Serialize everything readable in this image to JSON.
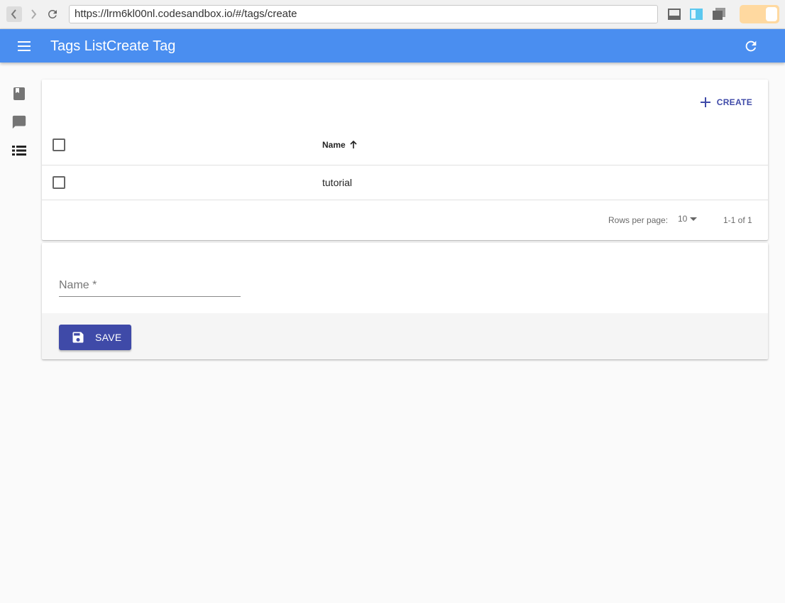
{
  "browser": {
    "url": "https://lrm6kl00nl.codesandbox.io/#/tags/create"
  },
  "app_bar": {
    "title": "Tags ListCreate Tag",
    "color": "#4a8ef0"
  },
  "sidebar": {
    "items": [
      {
        "icon": "book-icon"
      },
      {
        "icon": "comment-icon"
      },
      {
        "icon": "list-icon"
      }
    ]
  },
  "list": {
    "create_label": "CREATE",
    "columns": [
      {
        "label": "Name",
        "sort": "ascending"
      }
    ],
    "rows": [
      {
        "name": "tutorial"
      }
    ],
    "pagination": {
      "rows_per_page_label": "Rows per page:",
      "rows_per_page": "10",
      "range": "1-1 of 1"
    }
  },
  "form": {
    "name_label": "Name *",
    "name_value": "",
    "save_label": "SAVE",
    "accent": "#3f4aa8"
  }
}
